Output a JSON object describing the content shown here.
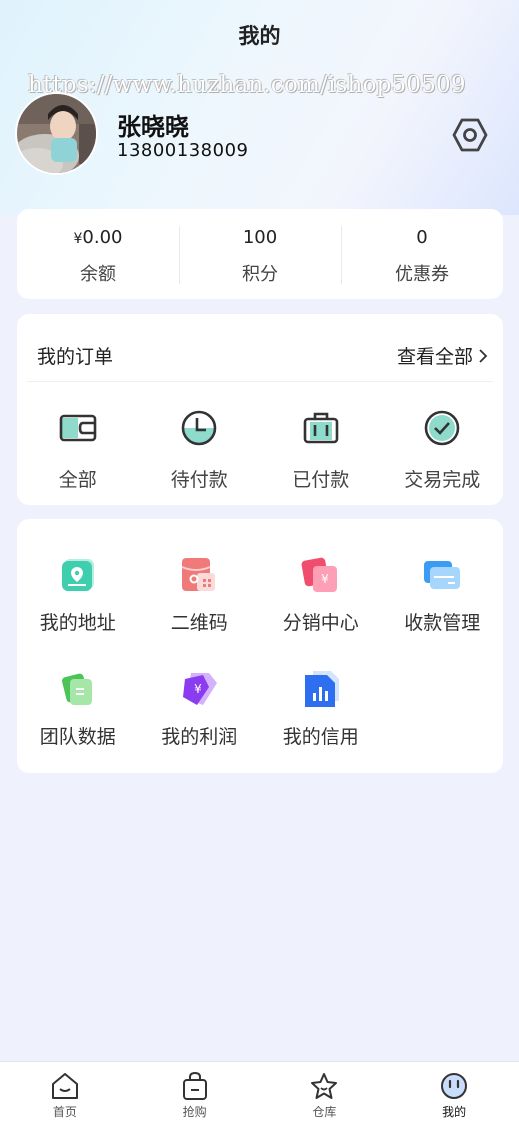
{
  "header": {
    "title": "我的"
  },
  "watermark": "https://www.huzhan.com/ishop50509",
  "user": {
    "name": "张晓晓",
    "phone": "13800138009"
  },
  "stats": [
    {
      "currency": "¥",
      "value": "0.00",
      "label": "余额"
    },
    {
      "currency": "",
      "value": "100",
      "label": "积分"
    },
    {
      "currency": "",
      "value": "0",
      "label": "优惠券"
    }
  ],
  "orders": {
    "title": "我的订单",
    "view_all": "查看全部",
    "items": [
      {
        "label": "全部",
        "icon": "wallet-icon"
      },
      {
        "label": "待付款",
        "icon": "clock-icon"
      },
      {
        "label": "已付款",
        "icon": "suitcase-icon"
      },
      {
        "label": "交易完成",
        "icon": "check-circle-icon"
      }
    ]
  },
  "tools": [
    {
      "label": "我的地址",
      "icon": "location-icon"
    },
    {
      "label": "二维码",
      "icon": "qrcode-icon"
    },
    {
      "label": "分销中心",
      "icon": "distribution-icon"
    },
    {
      "label": "收款管理",
      "icon": "card-icon"
    },
    {
      "label": "团队数据",
      "icon": "team-data-icon"
    },
    {
      "label": "我的利润",
      "icon": "profit-icon"
    },
    {
      "label": "我的信用",
      "icon": "credit-icon"
    }
  ],
  "tabbar": [
    {
      "label": "首页",
      "icon": "home-icon"
    },
    {
      "label": "抢购",
      "icon": "shopping-bag-icon"
    },
    {
      "label": "仓库",
      "icon": "star-icon"
    },
    {
      "label": "我的",
      "icon": "face-icon",
      "active": true
    }
  ],
  "colors": {
    "accent_mint": "#8edbcb",
    "icon_dark": "#333333",
    "page_bg": "#eff2fd"
  }
}
